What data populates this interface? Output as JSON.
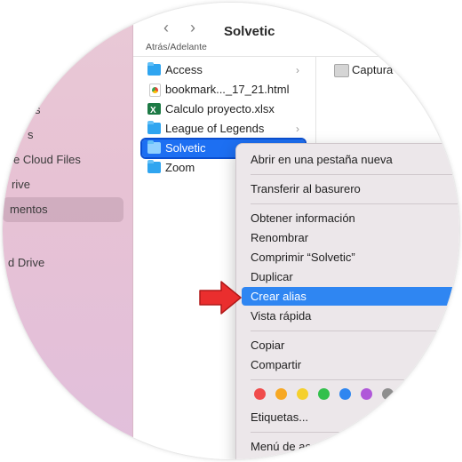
{
  "window": {
    "title": "Solvetic",
    "nav_label": "Atrás/Adelante"
  },
  "icons": {
    "back": "chevron-left-icon",
    "forward": "chevron-right-icon",
    "folder": "folder-icon",
    "chevron": "chevron-right-icon"
  },
  "sidebar": {
    "items": [
      {
        "label": "s"
      },
      {
        "label": "s"
      },
      {
        "label": "e Cloud Files"
      },
      {
        "label": "rive"
      },
      {
        "label": "mentos"
      },
      {
        "label": "d Drive"
      }
    ]
  },
  "column1": {
    "items": [
      {
        "label": "Access",
        "has_children": "›"
      },
      {
        "label": "bookmark..._17_21.html"
      },
      {
        "label": "Calculo proyecto.xlsx"
      },
      {
        "label": "League of Legends",
        "has_children": "›"
      },
      {
        "label": "Solvetic"
      },
      {
        "label": "Zoom"
      }
    ]
  },
  "column2": {
    "items": [
      {
        "label": "Captura"
      }
    ]
  },
  "context_menu": {
    "items": [
      {
        "label": "Abrir en una pestaña nueva"
      },
      {
        "label": "Transferir al basurero"
      },
      {
        "label": "Obtener información"
      },
      {
        "label": "Renombrar"
      },
      {
        "label": "Comprimir “Solvetic”"
      },
      {
        "label": "Duplicar"
      },
      {
        "label": "Crear alias"
      },
      {
        "label": "Vista rápida"
      },
      {
        "label": "Copiar"
      },
      {
        "label": "Compartir"
      },
      {
        "label": "Etiquetas..."
      },
      {
        "label": "Menú de ac"
      }
    ],
    "tag_colors": [
      "#f04b4b",
      "#f7a823",
      "#f5d02c",
      "#33c04c",
      "#2e86f0",
      "#b058d9",
      "#8e8e8e"
    ]
  },
  "colors": {
    "selection": "#1d6ff2",
    "menu_highlight": "#2f86f2",
    "arrow": "#ea2e2e"
  }
}
